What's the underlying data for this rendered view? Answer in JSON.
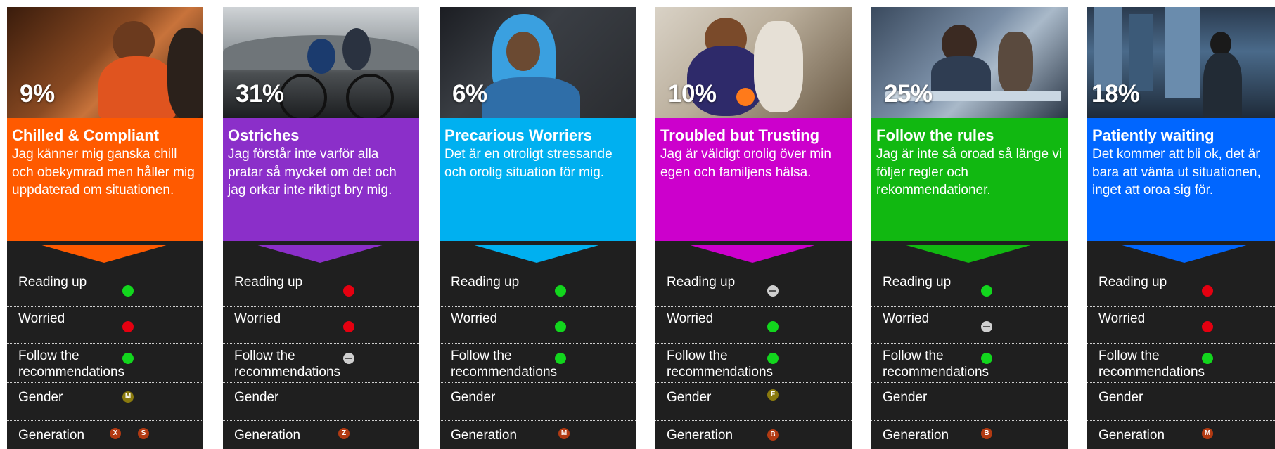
{
  "labels": {
    "reading_up": "Reading up",
    "worried": "Worried",
    "follow_line1": "Follow the",
    "follow_line2": "recommendations",
    "gender": "Gender",
    "generation": "Generation"
  },
  "cards": [
    {
      "percent": "9%",
      "title": "Chilled & Compliant",
      "description": "Jag känner mig ganska chill och obekymrad men håller mig uppdaterad om situationen.",
      "color": "#ff5a00",
      "reading_up": "green",
      "worried": "red",
      "follow": "green",
      "gender": [
        "M"
      ],
      "generation": [
        "X",
        "S"
      ]
    },
    {
      "percent": "31%",
      "title": "Ostriches",
      "description": "Jag förstår inte varför alla pratar så mycket om det och jag orkar inte riktigt bry mig.",
      "color": "#8b2fc9",
      "reading_up": "red",
      "worried": "red",
      "follow": "neutral",
      "gender": [],
      "generation": [
        "Z"
      ]
    },
    {
      "percent": "6%",
      "title": "Precarious Worriers",
      "description": "Det är en otroligt stressande och orolig situation för mig.",
      "color": "#00b0f0",
      "reading_up": "green",
      "worried": "green",
      "follow": "green",
      "gender": [],
      "generation": [
        "M"
      ]
    },
    {
      "percent": "10%",
      "title": "Troubled but Trusting",
      "description": "Jag är väldigt orolig över min egen och familjens hälsa.",
      "color": "#cc00cc",
      "reading_up": "neutral",
      "worried": "green",
      "follow": "green",
      "gender": [
        "F"
      ],
      "generation": [
        "B"
      ]
    },
    {
      "percent": "25%",
      "title": "Follow the rules",
      "description": "Jag är inte så oroad så länge vi följer regler och rekommendationer.",
      "color": "#11b811",
      "reading_up": "green",
      "worried": "neutral",
      "follow": "green",
      "gender": [],
      "generation": [
        "B"
      ]
    },
    {
      "percent": "18%",
      "title": "Patiently waiting",
      "description": "Det kommer att bli ok, det är bara att vänta ut situationen, inget att oroa sig för.",
      "color": "#0066ff",
      "reading_up": "red",
      "worried": "red",
      "follow": "green",
      "gender": [],
      "generation": [
        "M"
      ]
    }
  ]
}
